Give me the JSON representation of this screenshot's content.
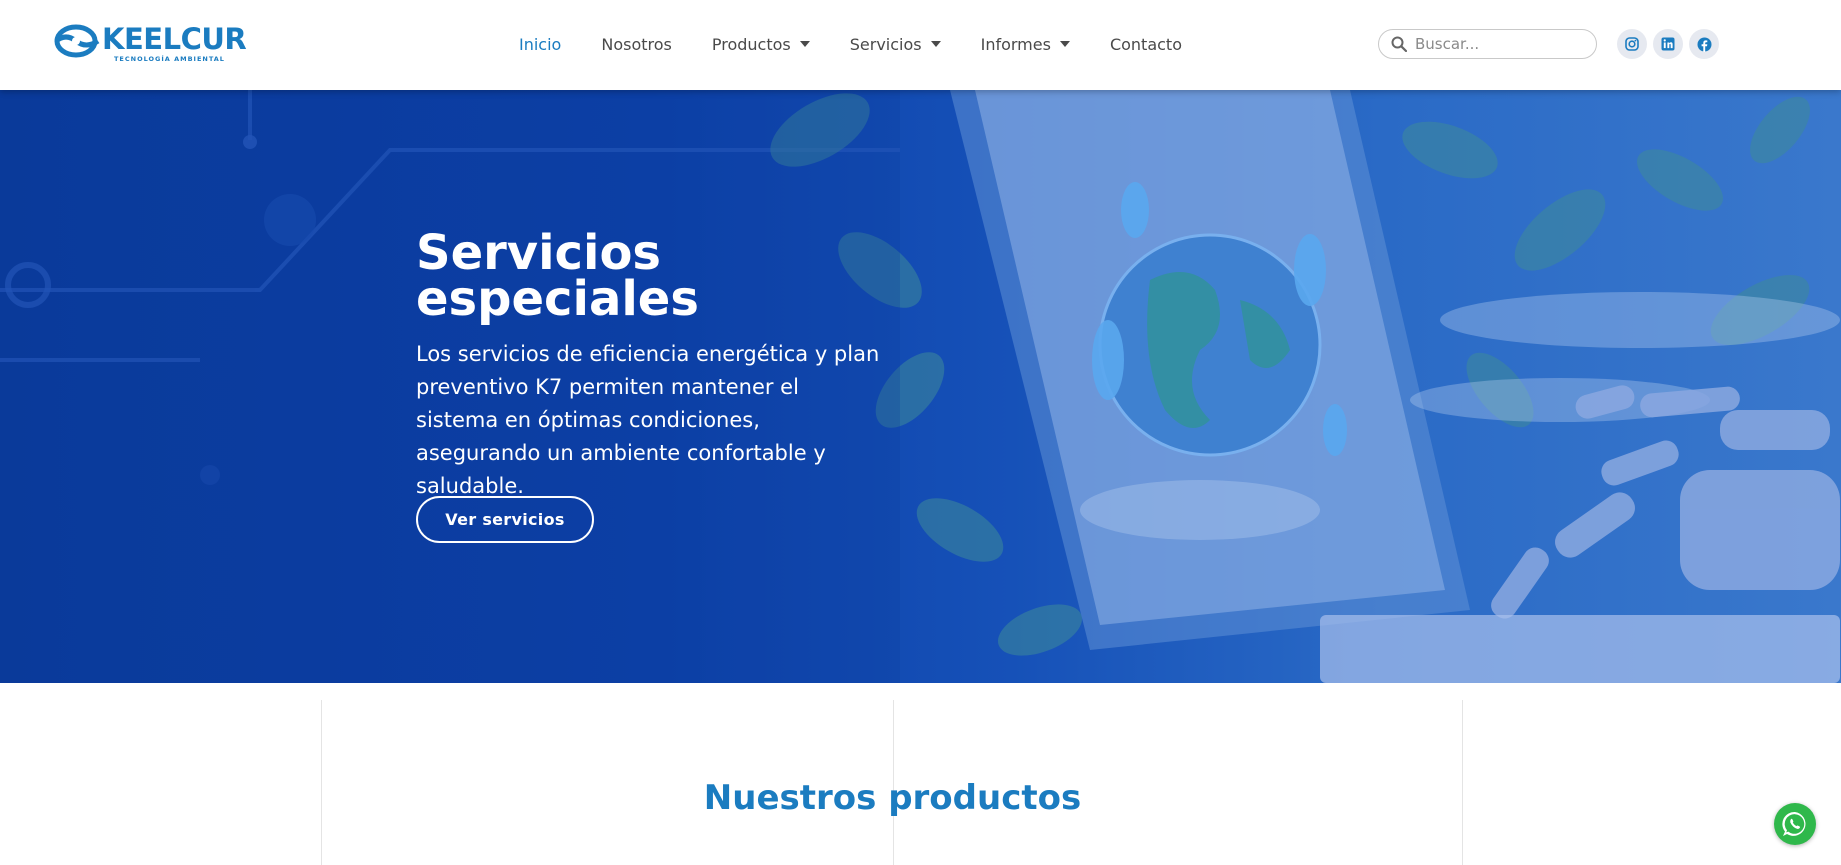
{
  "brand": {
    "name": "KEELCUR",
    "tagline": "TECNOLOGÍA AMBIENTAL",
    "color": "#1b7cc0"
  },
  "nav": {
    "items": [
      {
        "label": "Inicio",
        "active": true,
        "dropdown": false
      },
      {
        "label": "Nosotros",
        "active": false,
        "dropdown": false
      },
      {
        "label": "Productos",
        "active": false,
        "dropdown": true
      },
      {
        "label": "Servicios",
        "active": false,
        "dropdown": true
      },
      {
        "label": "Informes",
        "active": false,
        "dropdown": true
      },
      {
        "label": "Contacto",
        "active": false,
        "dropdown": false
      }
    ]
  },
  "search": {
    "placeholder": "Buscar...",
    "icon": "search-icon"
  },
  "socials": [
    "instagram-icon",
    "linkedin-icon",
    "facebook-icon"
  ],
  "hero": {
    "title": "Servicios especiales",
    "text": "Los servicios de eficiencia energética y plan preventivo K7 permiten mantener el sistema en óptimas condiciones, asegurando un ambiente confortable y saludable.",
    "button_label": "Ver servicios"
  },
  "products": {
    "title": "Nuestros productos"
  },
  "colors": {
    "accent": "#1b7cc0",
    "hero_bg": "#0c40a8",
    "whatsapp": "#2fb84b"
  }
}
